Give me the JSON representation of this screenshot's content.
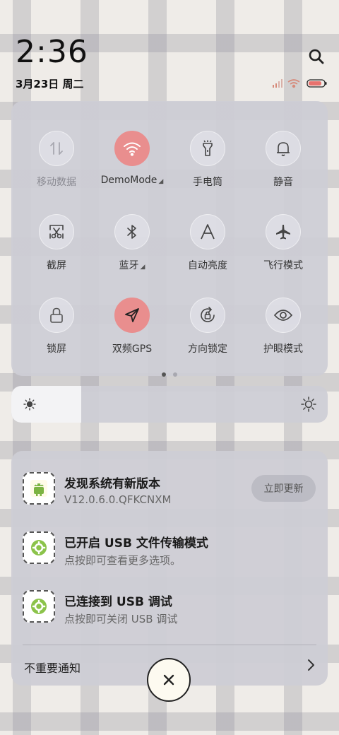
{
  "status_bar": {
    "time": "2:36",
    "date": "3月23日 周二"
  },
  "colors": {
    "active_tile": "#e98e8e",
    "panel_bg": "#cdcdd5",
    "page_bg": "#efece8"
  },
  "control_center": {
    "tiles": [
      {
        "label": "移动数据",
        "icon": "mobile-data-icon",
        "active": false,
        "disabled": true
      },
      {
        "label": "DemoMode",
        "icon": "wifi-icon",
        "active": true,
        "has_dropdown": true
      },
      {
        "label": "手电筒",
        "icon": "flashlight-icon",
        "active": false
      },
      {
        "label": "静音",
        "icon": "bell-icon",
        "active": false
      },
      {
        "label": "截屏",
        "icon": "screenshot-icon",
        "active": false
      },
      {
        "label": "蓝牙",
        "icon": "bluetooth-icon",
        "active": false,
        "has_dropdown": true
      },
      {
        "label": "自动亮度",
        "icon": "auto-brightness-icon",
        "active": false
      },
      {
        "label": "飞行模式",
        "icon": "airplane-icon",
        "active": false
      },
      {
        "label": "锁屏",
        "icon": "lock-icon",
        "active": false
      },
      {
        "label": "双频GPS",
        "icon": "gps-icon",
        "active": true
      },
      {
        "label": "方向锁定",
        "icon": "rotation-lock-icon",
        "active": false
      },
      {
        "label": "护眼模式",
        "icon": "eye-icon",
        "active": false
      }
    ],
    "page_indicator": {
      "current": 1,
      "total": 2
    },
    "brightness": 0.22
  },
  "notifications": {
    "items": [
      {
        "title": "发现系统有新版本",
        "subtitle": "V12.0.6.0.QFKCNXM",
        "icon": "android-update-icon",
        "action": "立即更新"
      },
      {
        "title": "已开启 USB 文件传输模式",
        "subtitle": "点按即可查看更多选项。",
        "icon": "settings-gear-icon"
      },
      {
        "title": "已连接到 USB 调试",
        "subtitle": "点按即可关闭 USB 调试",
        "icon": "settings-gear-icon"
      }
    ],
    "unimportant_label": "不重要通知"
  }
}
